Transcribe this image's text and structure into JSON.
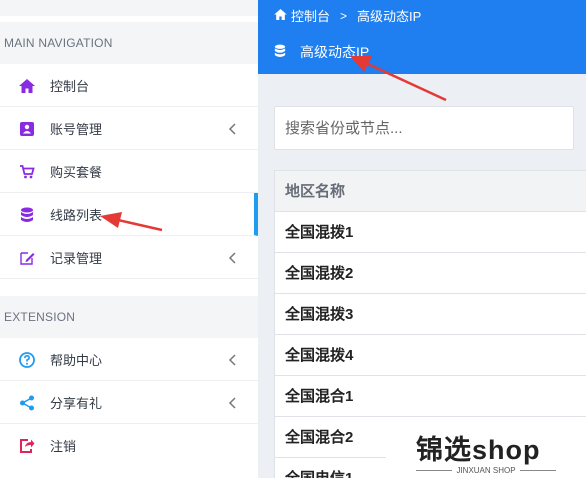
{
  "sidebar": {
    "sections": [
      {
        "header": "MAIN NAVIGATION",
        "items": [
          {
            "label": "控制台",
            "icon": "home-icon",
            "color": "#8a2be2",
            "has_submenu": false
          },
          {
            "label": "账号管理",
            "icon": "id-card-icon",
            "color": "#8a2be2",
            "has_submenu": true
          },
          {
            "label": "购买套餐",
            "icon": "cart-icon",
            "color": "#8a2be2",
            "has_submenu": false
          },
          {
            "label": "线路列表",
            "icon": "database-icon",
            "color": "#8a2be2",
            "has_submenu": false,
            "active": true
          },
          {
            "label": "记录管理",
            "icon": "edit-icon",
            "color": "#8a2be2",
            "has_submenu": true
          }
        ]
      },
      {
        "header": "EXTENSION",
        "items": [
          {
            "label": "帮助中心",
            "icon": "help-icon",
            "color": "#1f9bf0",
            "has_submenu": true
          },
          {
            "label": "分享有礼",
            "icon": "share-icon",
            "color": "#1f9bf0",
            "has_submenu": true
          },
          {
            "label": "注销",
            "icon": "logout-icon",
            "color": "#e0245e",
            "has_submenu": false
          }
        ]
      }
    ]
  },
  "header": {
    "breadcrumb": {
      "home": "控制台",
      "separator": ">",
      "current": "高级动态IP"
    },
    "title": "高级动态IP",
    "background": "#1f7ff0"
  },
  "search": {
    "placeholder": "搜索省份或节点..."
  },
  "table": {
    "column_header": "地区名称",
    "rows": [
      "全国混拨1",
      "全国混拨2",
      "全国混拨3",
      "全国混拨4",
      "全国混合1",
      "全国混合2",
      "全国电信1"
    ]
  },
  "watermark": {
    "title": "锦选shop",
    "subtitle": "JINXUAN SHOP"
  },
  "colors": {
    "accent": "#1f7ff0",
    "active_indicator": "#1f9bf0",
    "annotation_arrow": "#e53935"
  }
}
